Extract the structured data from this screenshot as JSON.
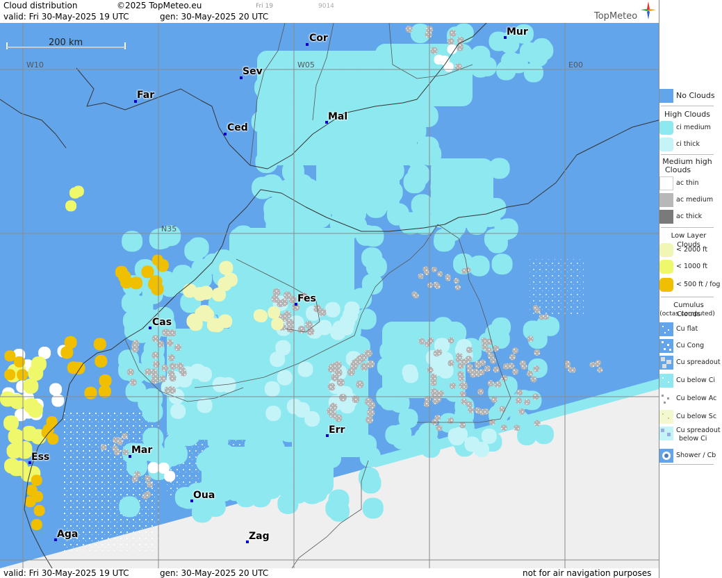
{
  "header": {
    "title": "Cloud distribution",
    "copyright": "©2025 TopMeteo.eu",
    "frame_label": "Fri 19",
    "code": "9014",
    "valid": "valid:  Fri  30-May-2025  19 UTC",
    "gen": "gen: 30-May-2025 20 UTC",
    "brand": "TopMeteo"
  },
  "footer": {
    "valid": "valid:  Fri  30-May-2025  19 UTC",
    "gen": "gen: 30-May-2025 20 UTC",
    "disclaimer": "not for air navigation purposes"
  },
  "map": {
    "scale_label": "200 km",
    "grid_labels": {
      "w10": "W10",
      "w05": "W05",
      "e00": "E00",
      "n35": "N35"
    },
    "cities": [
      {
        "name": "Cor"
      },
      {
        "name": "Mur"
      },
      {
        "name": "Sev"
      },
      {
        "name": "Far"
      },
      {
        "name": "Ced"
      },
      {
        "name": "Mal"
      },
      {
        "name": "Fes"
      },
      {
        "name": "Cas"
      },
      {
        "name": "Err"
      },
      {
        "name": "Mar"
      },
      {
        "name": "Ess"
      },
      {
        "name": "Oua"
      },
      {
        "name": "Aga"
      },
      {
        "name": "Zag"
      }
    ]
  },
  "legend": {
    "no_clouds": "No Clouds",
    "high_title": "High Clouds",
    "ci_medium": "ci medium",
    "ci_thick": "ci thick",
    "medium_title_1": "Medium high",
    "medium_title_2": "Clouds",
    "ac_thin": "ac thin",
    "ac_medium": "ac medium",
    "ac_thick": "ac thick",
    "low_title": "Low Layer Clouds",
    "lt2000": "< 2000 ft",
    "lt1000": "< 1000 ft",
    "lt500": "< 500 ft / fog",
    "cu_title": "Cumulus Clouds",
    "cu_sub": "(octas computed)",
    "cu_flat": "Cu flat",
    "cu_cong": "Cu Cong",
    "cu_spread": "Cu spreadout",
    "cu_below_ci": "Cu below Ci",
    "cu_below_ac": "Cu below Ac",
    "cu_below_sc": "Cu below Sc",
    "cu_spread_ci_1": "Cu spreadout",
    "cu_spread_ci_2": "below Ci",
    "shower": "Shower / Cb"
  },
  "colors": {
    "no_clouds": "#62a5ea",
    "ci_medium": "#8de8f0",
    "ci_thick": "#c4f4f8",
    "ac_thin": "#ffffff",
    "ac_medium": "#b8b8b8",
    "ac_thick": "#7a7a7a",
    "low_2000": "#f2f6b4",
    "low_1000": "#eef86a",
    "low_500": "#f0c000",
    "nodata": "#efefef"
  }
}
